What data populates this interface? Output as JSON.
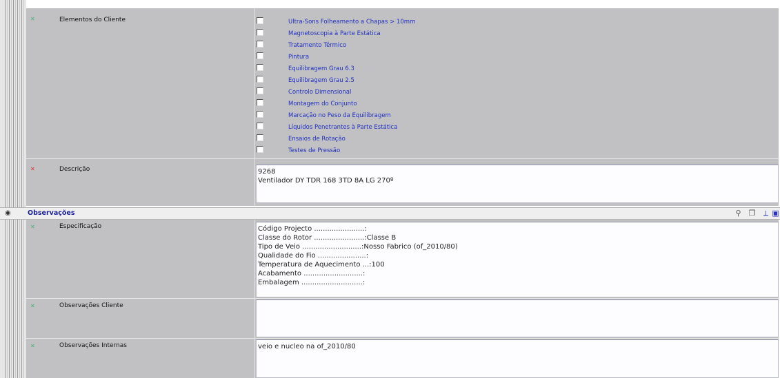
{
  "top_section": {
    "elementos_label": "Elementos do Cliente",
    "checkboxes": [
      "Ultra-Sons Folheamento a Chapas > 10mm",
      "Magnetoscopia à Parte Estática",
      "Tratamento Térmico",
      "Pintura",
      "Equilibragem Grau 6.3",
      "Equilibragem Grau 2.5",
      "Controlo Dimensional",
      "Montagem do Conjunto",
      "Marcação no Peso da Equilibragem",
      "Líquidos Penetrantes à Parte Estática",
      "Ensaios de Rotação",
      "Testes de Pressão"
    ],
    "descricao_label": "Descrição",
    "descricao_value": "9268\nVentilador DY TDR 168 3TD 8A LG 270º"
  },
  "observacoes": {
    "title": "Observações",
    "especificacao_label": "Especificação",
    "especificacao_value": "Código Projecto .......................:\nClasse do Rotor .......................:Classe B\nTipo de Veio ...........................:Nosso Fabrico (of_2010/80)\nQualidade do Fio ......................:\nTemperatura de Aquecimento ...:100\nAcabamento ...........................:\nEmbalagem ............................:",
    "obs_cliente_label": "Observações Cliente",
    "obs_cliente_value": "",
    "obs_internas_label": "Observações Internas",
    "obs_internas_value": "veio e nucleo na of_2010/80"
  },
  "icons": {
    "bullet_required": "red-bullet-icon",
    "bullet_optional": "green-bullet-icon",
    "toolbar": [
      "help-icon",
      "copy-icon",
      "edit-icon",
      "collapse-icon"
    ]
  },
  "colors": {
    "section_bg": "#c1c1c4",
    "link_text": "#1f2fbf",
    "title_text": "#1b1f9a"
  }
}
